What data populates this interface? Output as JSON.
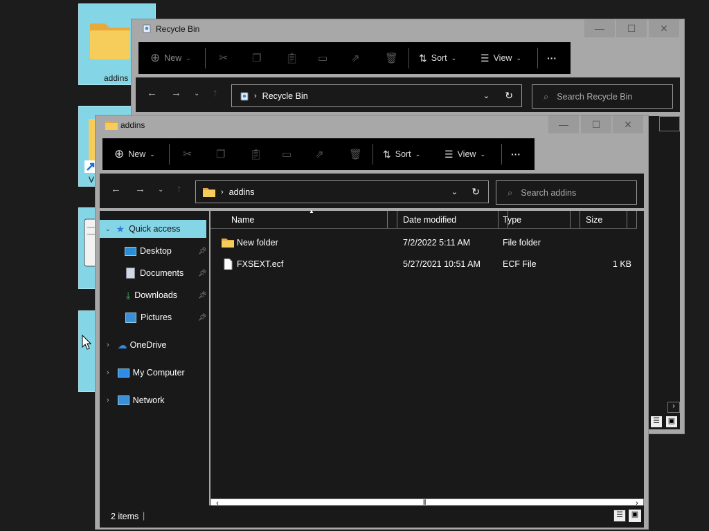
{
  "desktop": {
    "icon_addins_label": "addins",
    "icon_partial_label": "V"
  },
  "recycle_window": {
    "title": "Recycle Bin",
    "toolbar": {
      "new_label": "New",
      "sort_label": "Sort",
      "view_label": "View",
      "more_label": "···"
    },
    "address": {
      "location": "Recycle Bin"
    },
    "search": {
      "placeholder": "Search Recycle Bin"
    }
  },
  "addins_window": {
    "title": "addins",
    "toolbar": {
      "new_label": "New",
      "sort_label": "Sort",
      "view_label": "View",
      "more_label": "···"
    },
    "address": {
      "location": "addins"
    },
    "search": {
      "placeholder": "Search addins"
    },
    "sidebar": {
      "items": [
        {
          "label": "Quick access"
        },
        {
          "label": "Desktop"
        },
        {
          "label": "Documents"
        },
        {
          "label": "Downloads"
        },
        {
          "label": "Pictures"
        },
        {
          "label": "OneDrive"
        },
        {
          "label": "My Computer"
        },
        {
          "label": "Network"
        }
      ]
    },
    "columns": [
      "Name",
      "Date modified",
      "Type",
      "Size"
    ],
    "files": [
      {
        "name": "New folder",
        "date": "7/2/2022 5:11 AM",
        "type": "File folder",
        "size": ""
      },
      {
        "name": "FXSEXT.ecf",
        "date": "5/27/2021 10:51 AM",
        "type": "ECF File",
        "size": "1 KB"
      }
    ],
    "status": {
      "items_count": "2 items"
    }
  },
  "colors": {
    "accent": "#84d5e6",
    "folder": "#f5c542",
    "window_frame": "#a8a8a8",
    "content_bg": "#191919"
  }
}
